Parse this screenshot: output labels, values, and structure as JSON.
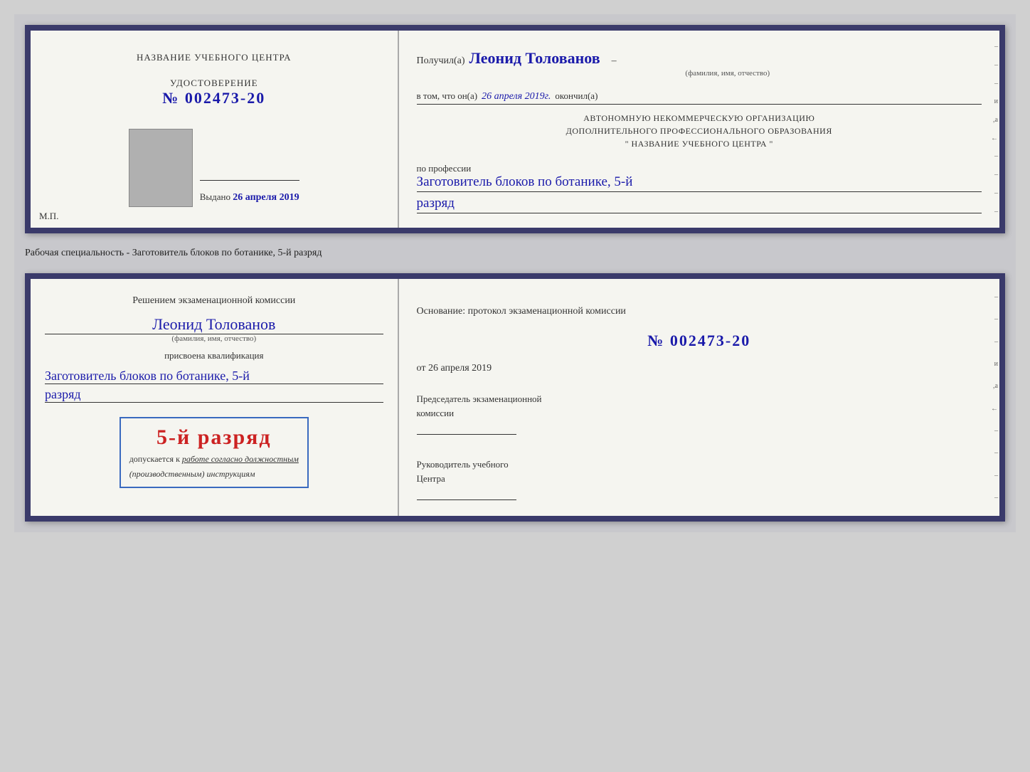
{
  "top_document": {
    "left": {
      "title": "НАЗВАНИЕ УЧЕБНОГО ЦЕНТРА",
      "cert_label": "УДОСТОВЕРЕНИЕ",
      "cert_number_prefix": "№",
      "cert_number": "002473-20",
      "issued_label": "Выдано",
      "issued_date": "26 апреля 2019",
      "mp_label": "М.П."
    },
    "right": {
      "received_label": "Получил(а)",
      "recipient_name": "Леонид Толованов",
      "recipient_subtitle": "(фамилия, имя, отчество)",
      "confirm_prefix": "в том, что он(а)",
      "confirm_date": "26 апреля 2019г.",
      "confirm_suffix": "окончил(а)",
      "org_line1": "АВТОНОМНУЮ НЕКОММЕРЧЕСКУЮ ОРГАНИЗАЦИЮ",
      "org_line2": "ДОПОЛНИТЕЛЬНОГО ПРОФЕССИОНАЛЬНОГО ОБРАЗОВАНИЯ",
      "org_line3": "\"   НАЗВАНИЕ УЧЕБНОГО ЦЕНТРА   \"",
      "profession_label": "по профессии",
      "profession_handwritten": "Заготовитель блоков по ботанике, 5-й",
      "razryad_handwritten": "разряд"
    }
  },
  "specialty_label": "Рабочая специальность - Заготовитель блоков по ботанике, 5-й разряд",
  "bottom_document": {
    "left": {
      "commission_intro": "Решением экзаменационной комиссии",
      "person_name": "Леонид Толованов",
      "fio_subtitle": "(фамилия, имя, отчество)",
      "qualification_label": "присвоена квалификация",
      "qualification_handwritten": "Заготовитель блоков по ботанике, 5-й",
      "razryad_handwritten": "разряд",
      "badge_rank": "5-й разряд",
      "badge_permission_prefix": "допускается к",
      "badge_permission_main": "работе согласно должностным",
      "badge_permission_italic": "(производственным) инструкциям"
    },
    "right": {
      "basis_label": "Основание: протокол экзаменационной комиссии",
      "protocol_number_prefix": "№",
      "protocol_number": "002473-20",
      "date_prefix": "от",
      "date_value": "26 апреля 2019",
      "chairman_title_line1": "Председатель экзаменационной",
      "chairman_title_line2": "комиссии",
      "head_title_line1": "Руководитель учебного",
      "head_title_line2": "Центра"
    }
  },
  "edge_marks": {
    "top": [
      "–",
      "–",
      "–",
      "и",
      ",а",
      "←",
      "–",
      "–",
      "–",
      "–"
    ],
    "bottom": [
      "–",
      "–",
      "–",
      "и",
      ",а",
      "←",
      "–",
      "–",
      "–",
      "–"
    ]
  }
}
